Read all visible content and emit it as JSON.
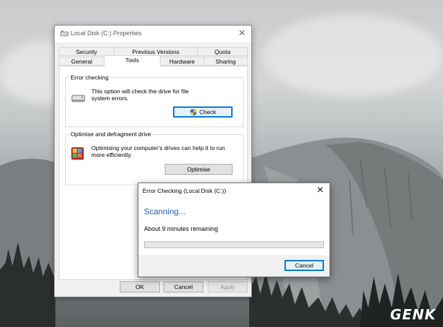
{
  "properties_dialog": {
    "title": "Local Disk (C:) Properties",
    "tabs_row1": [
      "Security",
      "Previous Versions",
      "Quota"
    ],
    "tabs_row2": [
      "General",
      "Tools",
      "Hardware",
      "Sharing"
    ],
    "active_tab": "Tools",
    "error_checking": {
      "legend": "Error checking",
      "description_line1": "This option will check the drive for file",
      "description_line2": "system errors.",
      "check_label": "Check"
    },
    "optimise": {
      "legend": "Optimise and defragment drive",
      "description_line1": "Optimising your computer's drives can help it to run",
      "description_line2": "more efficiently.",
      "optimise_label": "Optimise"
    },
    "buttons": {
      "ok": "OK",
      "cancel": "Cancel",
      "apply": "Apply"
    }
  },
  "error_dialog": {
    "title": "Error Checking (Local Disk (C:))",
    "heading": "Scanning...",
    "remaining": "About 9 minutes remaining",
    "progress_fraction": 0,
    "cancel_label": "Cancel"
  },
  "watermark": {
    "text": "GENK"
  },
  "colors": {
    "accent": "#0078d7",
    "heading": "#1e5aa8"
  }
}
